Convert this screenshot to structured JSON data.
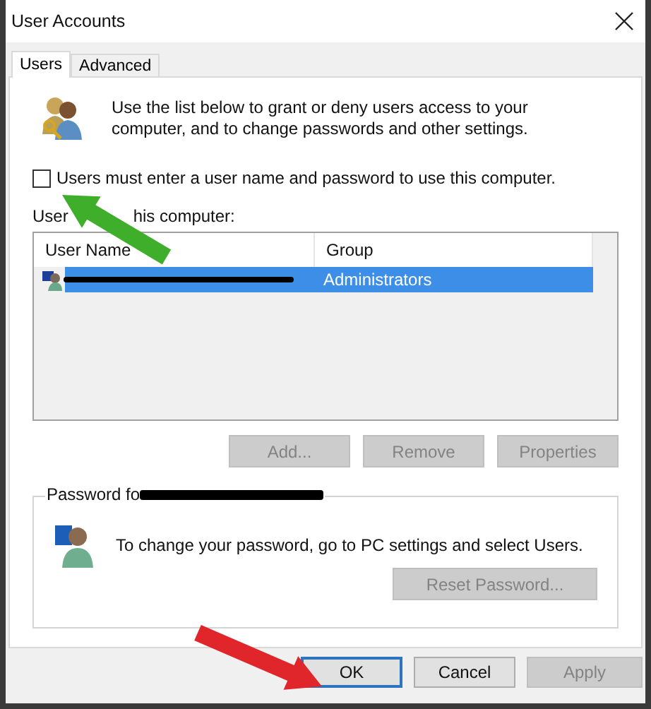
{
  "window": {
    "title": "User Accounts"
  },
  "tabs": [
    {
      "label": "Users",
      "selected": true
    },
    {
      "label": "Advanced",
      "selected": false
    }
  ],
  "description": "Use the list below to grant or deny users access to your computer, and to change passwords and other settings.",
  "login_checkbox": {
    "label": "Users must enter a user name and password to use this computer.",
    "checked": false
  },
  "users_label_parts": [
    "User",
    "his computer:"
  ],
  "user_list": {
    "columns": [
      "User Name",
      "Group"
    ],
    "rows": [
      {
        "group": "Administrators",
        "selected": true,
        "redacted": true
      }
    ]
  },
  "list_buttons": [
    {
      "label": "Add...",
      "disabled": true
    },
    {
      "label": "Remove",
      "disabled": true
    },
    {
      "label": "Properties",
      "disabled": true
    }
  ],
  "password_group": {
    "title": "Password fo",
    "redacted": true,
    "message": "To change your password, go to PC settings and select Users.",
    "button": {
      "label": "Reset Password...",
      "disabled": true
    }
  },
  "dialog_buttons": [
    {
      "label": "OK",
      "focused": true,
      "disabled": false
    },
    {
      "label": "Cancel",
      "focused": false,
      "disabled": false
    },
    {
      "label": "Apply",
      "focused": false,
      "disabled": true
    }
  ],
  "annotations": [
    {
      "kind": "arrow",
      "color": "#3fae2a"
    },
    {
      "kind": "arrow",
      "color": "#e0262a"
    }
  ]
}
